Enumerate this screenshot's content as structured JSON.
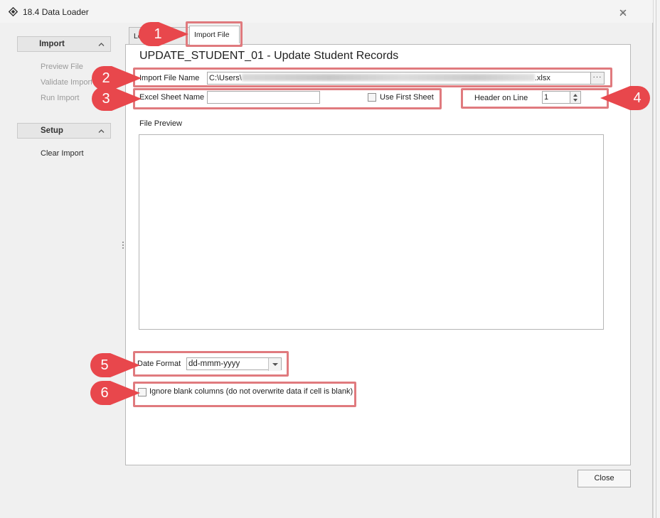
{
  "window": {
    "title": "18.4 Data Loader"
  },
  "sidebar": {
    "groups": [
      {
        "label": "Import",
        "items": [
          {
            "label": "Preview File",
            "enabled": false
          },
          {
            "label": "Validate Import",
            "enabled": false
          },
          {
            "label": "Run Import",
            "enabled": false
          }
        ]
      },
      {
        "label": "Setup",
        "items": [
          {
            "label": "Clear Import",
            "enabled": true
          }
        ]
      }
    ]
  },
  "tabs": [
    {
      "label": "Load Data",
      "active": false
    },
    {
      "label": "Import File",
      "active": true
    }
  ],
  "page": {
    "heading": "UPDATE_STUDENT_01 - Update Student Records"
  },
  "form": {
    "import_file_label": "Import File Name",
    "import_file_prefix": "C:\\Users\\",
    "import_file_suffix": ".xlsx",
    "browse_label": "···",
    "excel_sheet_label": "Excel Sheet Name",
    "excel_sheet_value": "",
    "use_first_sheet_label": "Use First Sheet",
    "use_first_sheet_checked": false,
    "header_line_label": "Header on Line",
    "header_line_value": "1",
    "file_preview_label": "File Preview",
    "date_format_label": "Date Format",
    "date_format_value": "dd-mmm-yyyy",
    "ignore_blank_label": "Ignore blank columns (do not overwrite data if cell is blank)",
    "ignore_blank_checked": false
  },
  "footer": {
    "close_label": "Close"
  },
  "callouts": [
    {
      "number": "1"
    },
    {
      "number": "2"
    },
    {
      "number": "3"
    },
    {
      "number": "4"
    },
    {
      "number": "5"
    },
    {
      "number": "6"
    }
  ],
  "colors": {
    "callout": "#e8474c",
    "highlight": "#e07a7e"
  }
}
